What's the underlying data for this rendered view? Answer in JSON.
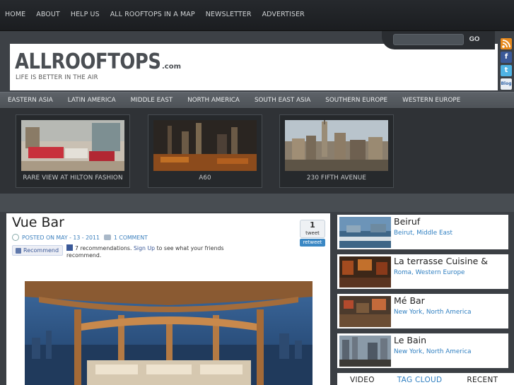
{
  "topnav": {
    "items": [
      {
        "label": "HOME"
      },
      {
        "label": "ABOUT"
      },
      {
        "label": "HELP US"
      },
      {
        "label": "ALL ROOFTOPS IN A MAP"
      },
      {
        "label": "NEWSLETTER"
      },
      {
        "label": "ADVERTISER"
      }
    ]
  },
  "header": {
    "logo": "ALLROOFTOPS",
    "logo_suffix": ".com",
    "tagline": "LIFE IS BETTER IN THE AIR",
    "search": {
      "value": "",
      "button_label": "GO"
    }
  },
  "social": {
    "rss": "RSS",
    "facebook": "f",
    "twitter": "t",
    "myspace": "Blog"
  },
  "catnav": {
    "items": [
      {
        "label": "EASTERN ASIA"
      },
      {
        "label": "LATIN AMERICA"
      },
      {
        "label": "MIDDLE EAST"
      },
      {
        "label": "NORTH AMERICA"
      },
      {
        "label": "SOUTH EAST ASIA"
      },
      {
        "label": "SOUTHERN EUROPE"
      },
      {
        "label": "WESTERN EUROPE"
      }
    ]
  },
  "featured": {
    "items": [
      {
        "caption": "RARE VIEW AT HILTON FASHION"
      },
      {
        "caption": "A60"
      },
      {
        "caption": "230 FIFTH AVENUE"
      }
    ]
  },
  "post": {
    "title": "Vue Bar",
    "date": "POSTED ON MAY - 13 - 2011",
    "comments": "1 COMMENT",
    "tweet_count": "1",
    "tweet_label": "tweet",
    "retweet_label": "retweet",
    "recommend_label": "Recommend",
    "fb_count_text": "7 recommendations.",
    "fb_signup_link": "Sign Up",
    "fb_rest_text": " to see what your friends recommend."
  },
  "sidebar": {
    "items": [
      {
        "title": "Beiruf",
        "location": "Beirut, Middle East"
      },
      {
        "title": "La terrasse Cuisine &",
        "location": "Roma, Western Europe"
      },
      {
        "title": "Mé Bar",
        "location": "New York, North America"
      },
      {
        "title": "Le Bain",
        "location": "New York, North America"
      }
    ],
    "tabs": [
      {
        "label": "VIDEO"
      },
      {
        "label": "TAG CLOUD"
      },
      {
        "label": "RECENT"
      }
    ]
  }
}
